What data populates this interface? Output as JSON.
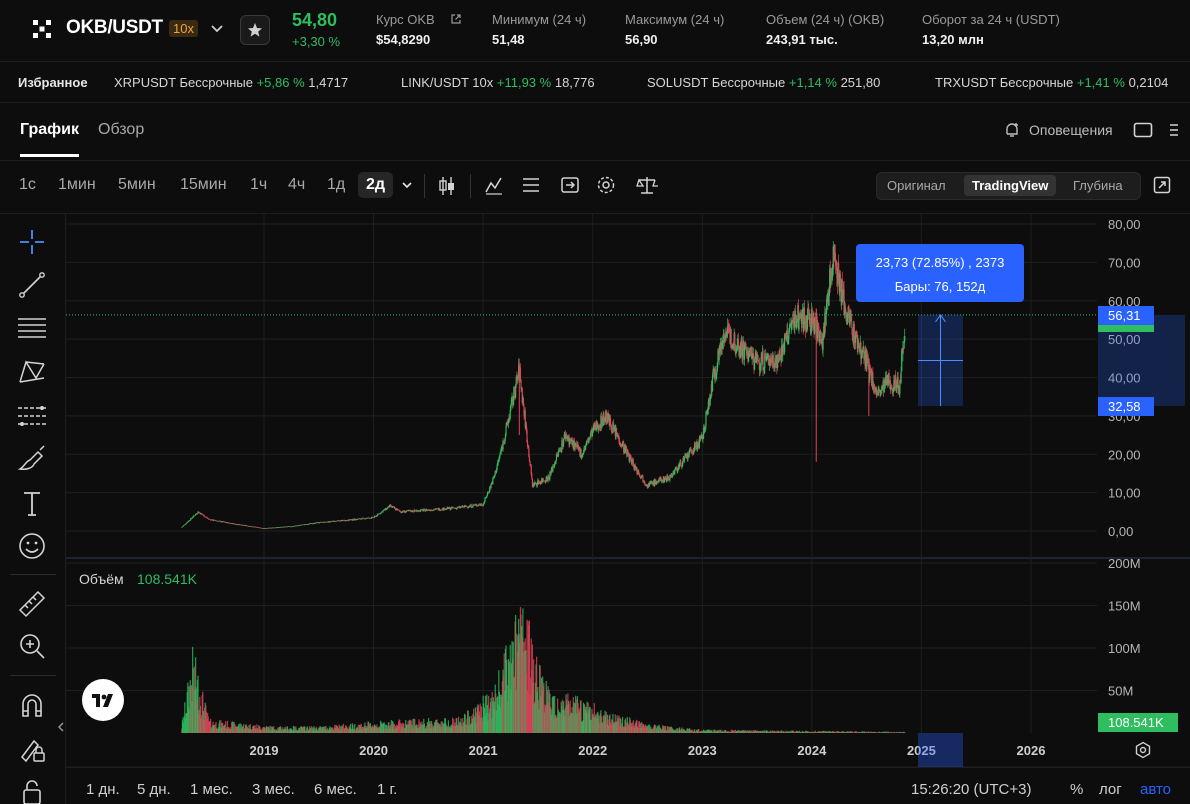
{
  "header": {
    "pair": "OKB/USDT",
    "leverage": "10x",
    "last_price": "54,80",
    "change": "+3,30 %",
    "stats": [
      {
        "label": "Курс OKB",
        "value": "$54,8290"
      },
      {
        "label": "Минимум (24 ч)",
        "value": "51,48"
      },
      {
        "label": "Максимум (24 ч)",
        "value": "56,90"
      },
      {
        "label": "Объем (24 ч) (OKB)",
        "value": "243,91 тыс."
      },
      {
        "label": "Оборот за 24 ч (USDT)",
        "value": "13,20 млн"
      }
    ]
  },
  "ticker": {
    "favorites_label": "Избранное",
    "items": [
      {
        "name": "XRPUSDT Бессрочные",
        "change": "+5,86 %",
        "price": "1,4717"
      },
      {
        "name": "LINK/USDT 10x",
        "change": "+11,93 %",
        "price": "18,776"
      },
      {
        "name": "SOLUSDT Бессрочные",
        "change": "+1,14 %",
        "price": "251,80"
      },
      {
        "name": "TRXUSDT Бессрочные",
        "change": "+1,41 %",
        "price": "0,2104"
      }
    ]
  },
  "tabs": {
    "chart": "График",
    "overview": "Обзор",
    "alerts": "Оповещения"
  },
  "timeframes": [
    "1с",
    "1мин",
    "5мин",
    "15мин",
    "1ч",
    "4ч",
    "1д",
    "2д"
  ],
  "selected_timeframe": "2д",
  "view_modes": [
    "Оригинал",
    "TradingView",
    "Глубина"
  ],
  "selected_view": "TradingView",
  "volume_label": "Объём",
  "volume_value": "108.541K",
  "measure": {
    "line1": "23,73 (72.85%) , 2373",
    "line2": "Бары: 76, 152д",
    "top_label": "56,31",
    "bottom_label": "32,58"
  },
  "bottom_bar": {
    "ranges": [
      "1 дн.",
      "5 дн.",
      "1 мес.",
      "3 мес.",
      "6 мес.",
      "1 г."
    ],
    "time": "15:26:20 (UTC+3)",
    "pct": "%",
    "log": "лог",
    "auto": "авто"
  },
  "colors": {
    "up": "#2ebd5f",
    "down": "#e0445a",
    "accent": "#2962ff",
    "bg": "#0d0d0d"
  },
  "chart_data": {
    "type": "candlestick",
    "title": "",
    "xlabel": "",
    "ylabel": "",
    "x_ticks": [
      "2019",
      "2020",
      "2021",
      "2022",
      "2023",
      "2024",
      "2025",
      "2026"
    ],
    "price_ticks": [
      "80,00",
      "70,00",
      "60,00",
      "50,00",
      "40,00",
      "30,00",
      "20,00",
      "10,00",
      "0,00"
    ],
    "price_range": [
      0,
      80
    ],
    "volume_ticks": [
      "200M",
      "150M",
      "100M",
      "50M"
    ],
    "volume_range": [
      0,
      200
    ],
    "last_price_line": 56.31,
    "price_series": [
      {
        "x": 2018.25,
        "y": 1.0
      },
      {
        "x": 2018.4,
        "y": 5.0
      },
      {
        "x": 2018.5,
        "y": 3.0
      },
      {
        "x": 2018.7,
        "y": 2.0
      },
      {
        "x": 2019.0,
        "y": 0.7
      },
      {
        "x": 2019.25,
        "y": 1.2
      },
      {
        "x": 2019.5,
        "y": 2.2
      },
      {
        "x": 2019.75,
        "y": 2.8
      },
      {
        "x": 2020.0,
        "y": 3.5
      },
      {
        "x": 2020.15,
        "y": 6.5
      },
      {
        "x": 2020.25,
        "y": 5.0
      },
      {
        "x": 2020.5,
        "y": 5.5
      },
      {
        "x": 2020.75,
        "y": 6.0
      },
      {
        "x": 2021.0,
        "y": 7.0
      },
      {
        "x": 2021.1,
        "y": 14.0
      },
      {
        "x": 2021.2,
        "y": 25.0
      },
      {
        "x": 2021.33,
        "y": 42.0
      },
      {
        "x": 2021.45,
        "y": 12.0
      },
      {
        "x": 2021.6,
        "y": 14.0
      },
      {
        "x": 2021.75,
        "y": 25.0
      },
      {
        "x": 2021.9,
        "y": 20.0
      },
      {
        "x": 2022.0,
        "y": 26.0
      },
      {
        "x": 2022.12,
        "y": 30.0
      },
      {
        "x": 2022.3,
        "y": 21.0
      },
      {
        "x": 2022.4,
        "y": 16.0
      },
      {
        "x": 2022.5,
        "y": 12.0
      },
      {
        "x": 2022.7,
        "y": 14.0
      },
      {
        "x": 2022.85,
        "y": 19.0
      },
      {
        "x": 2023.0,
        "y": 24.0
      },
      {
        "x": 2023.1,
        "y": 40.0
      },
      {
        "x": 2023.2,
        "y": 52.0
      },
      {
        "x": 2023.35,
        "y": 48.0
      },
      {
        "x": 2023.5,
        "y": 44.0
      },
      {
        "x": 2023.7,
        "y": 45.0
      },
      {
        "x": 2023.85,
        "y": 56.0
      },
      {
        "x": 2024.0,
        "y": 55.0
      },
      {
        "x": 2024.1,
        "y": 50.0
      },
      {
        "x": 2024.2,
        "y": 73.0
      },
      {
        "x": 2024.3,
        "y": 58.0
      },
      {
        "x": 2024.4,
        "y": 50.0
      },
      {
        "x": 2024.5,
        "y": 44.0
      },
      {
        "x": 2024.6,
        "y": 35.0
      },
      {
        "x": 2024.7,
        "y": 39.0
      },
      {
        "x": 2024.8,
        "y": 38.0
      },
      {
        "x": 2024.85,
        "y": 54.8
      }
    ],
    "volume_series": [
      {
        "x": 2018.25,
        "y": 8
      },
      {
        "x": 2018.35,
        "y": 75
      },
      {
        "x": 2018.5,
        "y": 12
      },
      {
        "x": 2018.9,
        "y": 8
      },
      {
        "x": 2019.1,
        "y": 6
      },
      {
        "x": 2019.5,
        "y": 6
      },
      {
        "x": 2020.0,
        "y": 10
      },
      {
        "x": 2020.3,
        "y": 12
      },
      {
        "x": 2020.8,
        "y": 14
      },
      {
        "x": 2021.1,
        "y": 40
      },
      {
        "x": 2021.35,
        "y": 120
      },
      {
        "x": 2021.6,
        "y": 40
      },
      {
        "x": 2021.9,
        "y": 30
      },
      {
        "x": 2022.2,
        "y": 18
      },
      {
        "x": 2022.5,
        "y": 8
      },
      {
        "x": 2023.0,
        "y": 3
      },
      {
        "x": 2024.0,
        "y": 2
      },
      {
        "x": 2024.85,
        "y": 1
      }
    ]
  }
}
